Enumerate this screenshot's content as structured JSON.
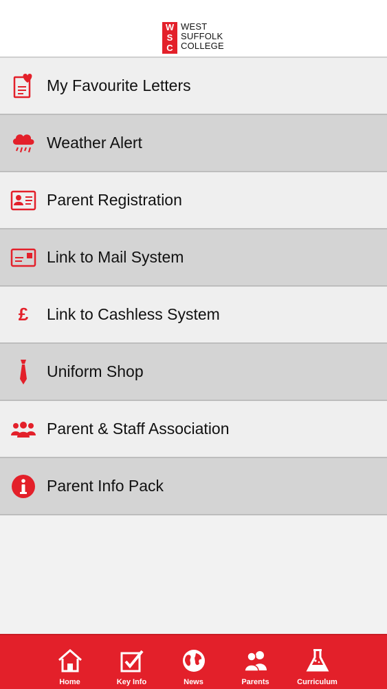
{
  "header": {
    "logo_letters": [
      "W",
      "S",
      "C"
    ],
    "logo_lines": [
      "WEST",
      "SUFFOLK",
      "COLLEGE"
    ]
  },
  "accent_color": "#e3202a",
  "menu": {
    "items": [
      {
        "label": "My Favourite Letters",
        "icon": "favourite-letter-icon"
      },
      {
        "label": "Weather Alert",
        "icon": "rain-cloud-icon"
      },
      {
        "label": "Parent Registration",
        "icon": "id-card-icon"
      },
      {
        "label": "Link to Mail System",
        "icon": "mail-card-icon"
      },
      {
        "label": "Link to Cashless System",
        "icon": "pound-icon",
        "glyph": "£"
      },
      {
        "label": "Uniform Shop",
        "icon": "tie-icon"
      },
      {
        "label": "Parent & Staff Association",
        "icon": "group-people-icon"
      },
      {
        "label": "Parent Info Pack",
        "icon": "info-icon"
      }
    ]
  },
  "tabbar": {
    "tabs": [
      {
        "label": "Home",
        "icon": "home-icon"
      },
      {
        "label": "Key Info",
        "icon": "checkbox-icon"
      },
      {
        "label": "News",
        "icon": "globe-icon"
      },
      {
        "label": "Parents",
        "icon": "people-icon",
        "active": true
      },
      {
        "label": "Curriculum",
        "icon": "flask-icon"
      }
    ]
  }
}
